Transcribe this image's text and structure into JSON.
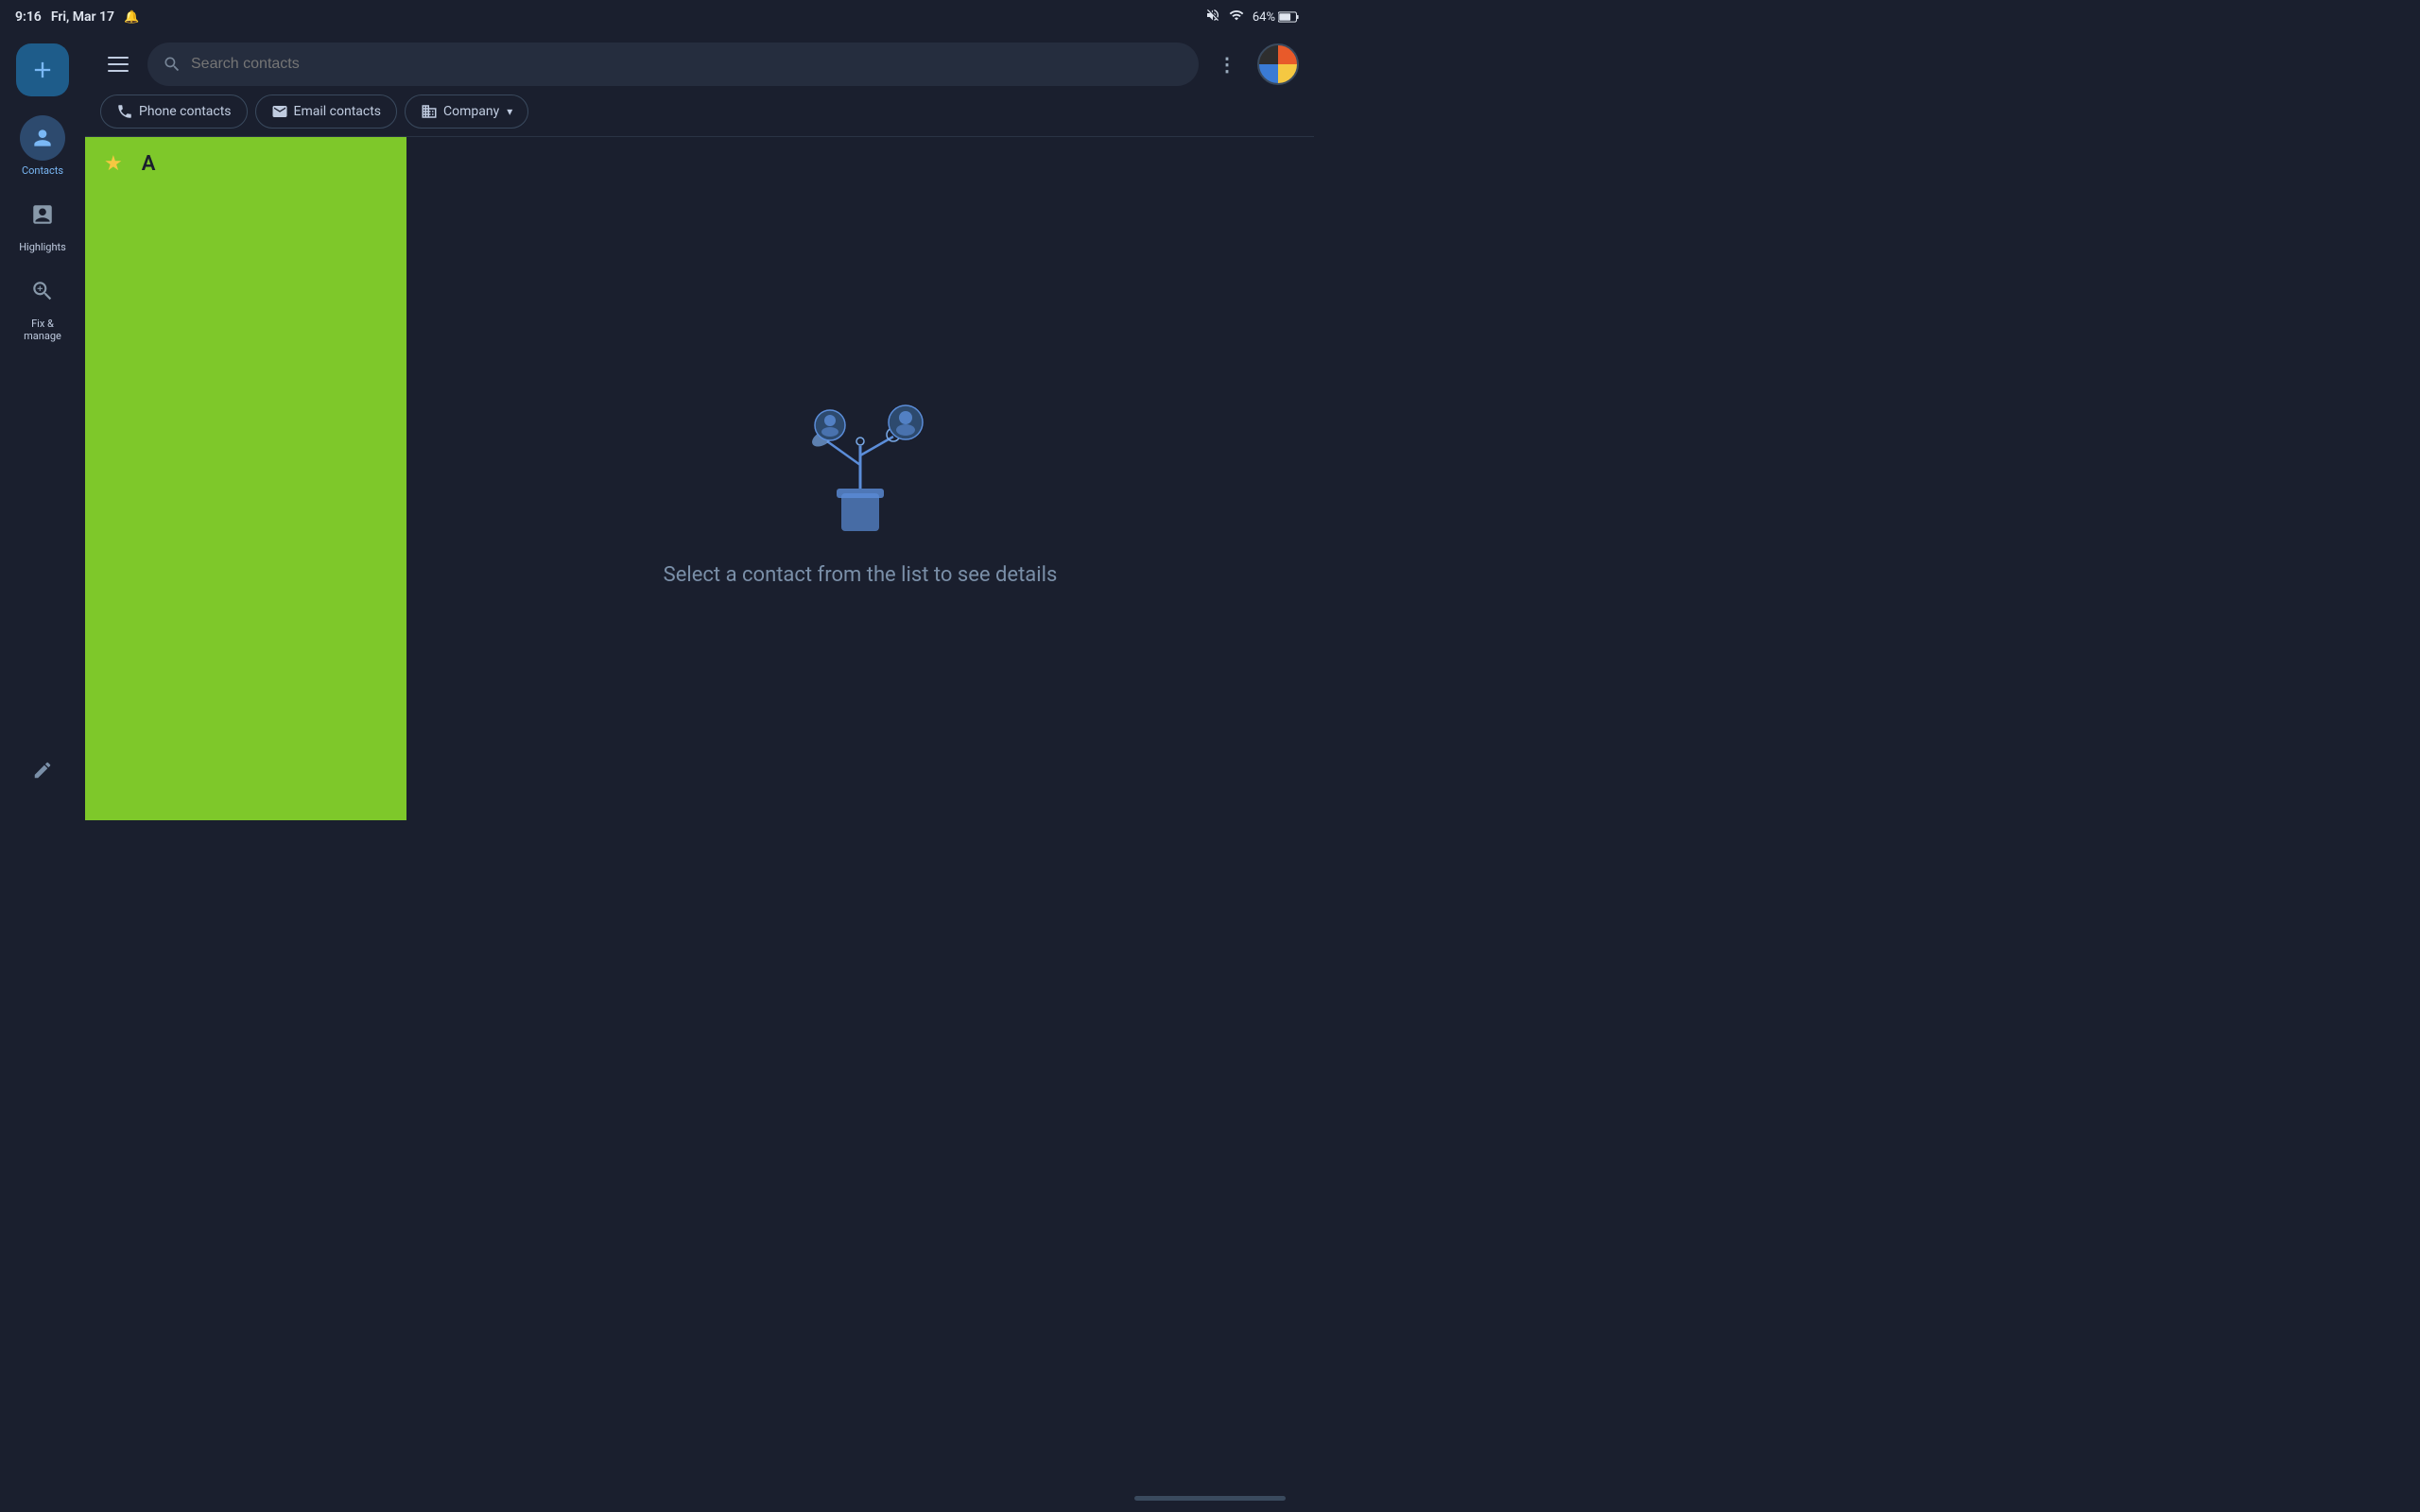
{
  "statusBar": {
    "time": "9:16",
    "date": "Fri, Mar 17",
    "batteryPercent": "64%"
  },
  "header": {
    "searchPlaceholder": "Search contacts",
    "moreIcon": "⋮"
  },
  "filterTabs": [
    {
      "id": "phone",
      "label": "Phone contacts",
      "icon": "phone",
      "active": true,
      "hasDropdown": false
    },
    {
      "id": "email",
      "label": "Email contacts",
      "icon": "email",
      "active": false,
      "hasDropdown": false
    },
    {
      "id": "company",
      "label": "Company",
      "icon": "company",
      "active": false,
      "hasDropdown": true
    }
  ],
  "sidebar": {
    "fabLabel": "+",
    "items": [
      {
        "id": "contacts",
        "label": "Contacts",
        "icon": "person",
        "active": true
      },
      {
        "id": "highlights",
        "label": "Highlights",
        "icon": "highlight",
        "active": false
      },
      {
        "id": "fix",
        "label": "Fix & manage",
        "icon": "wrench",
        "active": false
      }
    ],
    "bottomItem": {
      "id": "edit",
      "icon": "edit"
    }
  },
  "listPanel": {
    "starSection": true,
    "letterSection": "A"
  },
  "detailPanel": {
    "message": "Select a contact from the list to see details"
  }
}
